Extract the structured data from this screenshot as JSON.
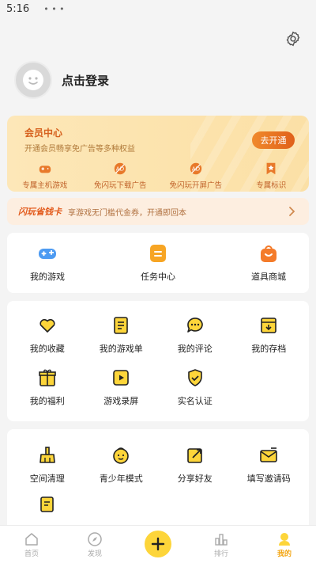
{
  "status_bar": {
    "time": "5:16",
    "icon": "notification-dots-icon"
  },
  "header": {
    "settings_icon": "gear-icon"
  },
  "profile": {
    "avatar_icon": "smiley-avatar-icon",
    "login_label": "点击登录"
  },
  "vip": {
    "title": "会员中心",
    "subtitle": "开通会员畅享免广告等多种权益",
    "button_label": "去开通",
    "benefits": [
      {
        "label": "专属主机游戏",
        "icon": "gamepad-icon"
      },
      {
        "label": "免闪玩下载广告",
        "icon": "no-ad-icon"
      },
      {
        "label": "免闪玩开屏广告",
        "icon": "no-ad-icon"
      },
      {
        "label": "专属标识",
        "icon": "star-badge-icon"
      }
    ]
  },
  "money_card": {
    "title": "闪玩省钱卡",
    "description": "享游戏无门槛代金券，开通即回本",
    "arrow_icon": "chevron-right-icon"
  },
  "quick_actions": [
    {
      "label": "我的游戏",
      "icon": "gamepad-icon"
    },
    {
      "label": "任务中心",
      "icon": "task-icon"
    },
    {
      "label": "道具商城",
      "icon": "shopping-bag-icon"
    }
  ],
  "section2": [
    {
      "label": "我的收藏",
      "icon": "heart-icon"
    },
    {
      "label": "我的游戏单",
      "icon": "list-icon"
    },
    {
      "label": "我的评论",
      "icon": "comment-icon"
    },
    {
      "label": "我的存档",
      "icon": "archive-icon"
    },
    {
      "label": "我的福利",
      "icon": "gift-icon"
    },
    {
      "label": "游戏录屏",
      "icon": "video-icon"
    },
    {
      "label": "实名认证",
      "icon": "shield-check-icon"
    }
  ],
  "section3": [
    {
      "label": "空间清理",
      "icon": "broom-icon"
    },
    {
      "label": "青少年模式",
      "icon": "child-face-icon"
    },
    {
      "label": "分享好友",
      "icon": "share-icon"
    },
    {
      "label": "填写邀请码",
      "icon": "envelope-icon"
    },
    {
      "label": "",
      "icon": "edit-note-icon"
    }
  ],
  "bottom_nav": [
    {
      "label": "首页",
      "icon": "home-icon",
      "active": false
    },
    {
      "label": "发现",
      "icon": "compass-icon",
      "active": false
    },
    {
      "label": "",
      "icon": "plus-icon",
      "active": false
    },
    {
      "label": "排行",
      "icon": "ranking-icon",
      "active": false
    },
    {
      "label": "我的",
      "icon": "profile-icon",
      "active": true
    }
  ],
  "colors": {
    "accent": "#FDD53A",
    "vip_text": "#D6611E",
    "active_nav": "#F3A512"
  }
}
